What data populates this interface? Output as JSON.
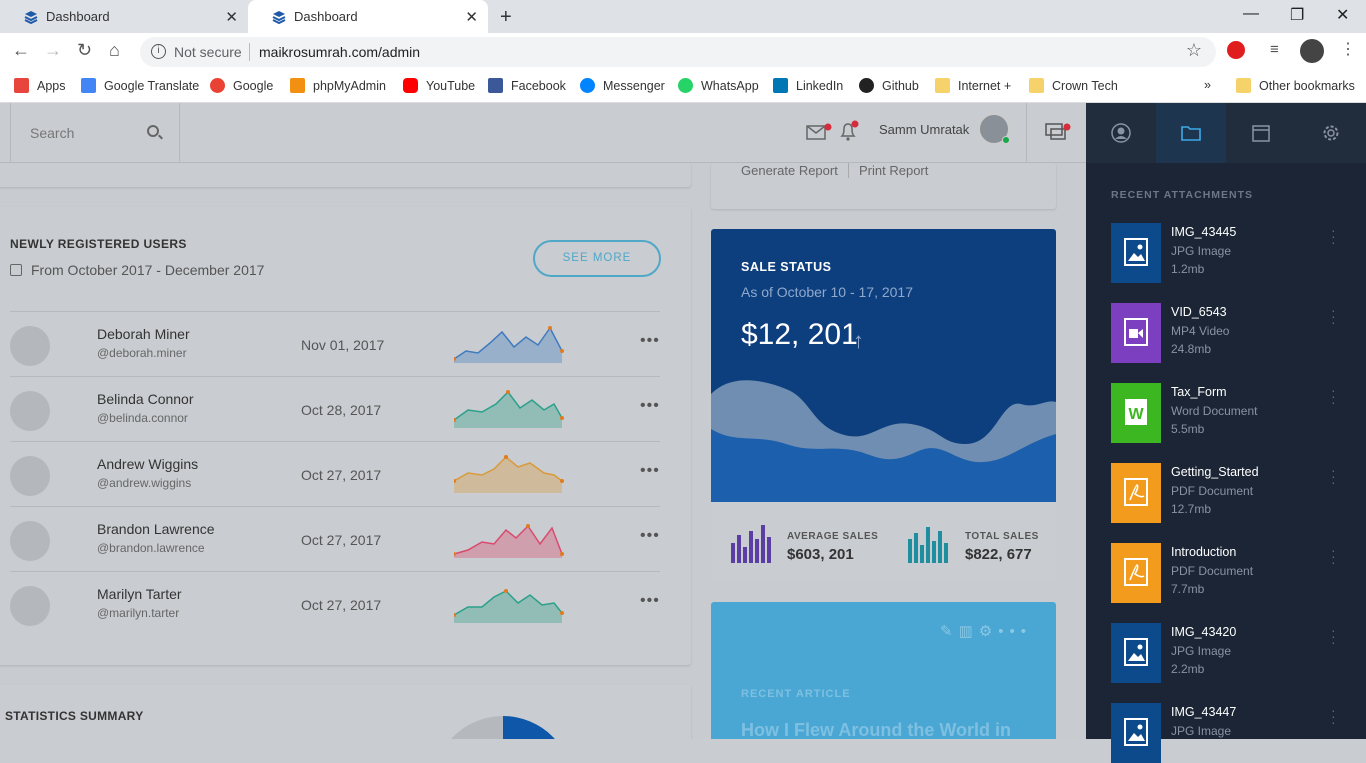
{
  "browser": {
    "tabs": [
      {
        "title": "Dashboard",
        "active": false
      },
      {
        "title": "Dashboard",
        "active": true
      }
    ],
    "address": {
      "security": "Not secure",
      "url": "maikrosumrah.com/admin"
    },
    "bookmarks": [
      {
        "label": "Apps",
        "icon": "apps-grid-icon",
        "color": "#e8453c"
      },
      {
        "label": "Google Translate",
        "icon": "translate-icon",
        "color": "#4285f4"
      },
      {
        "label": "Google",
        "icon": "google-icon",
        "color": "#ea4335"
      },
      {
        "label": "phpMyAdmin",
        "icon": "phpmyadmin-icon",
        "color": "#f29111"
      },
      {
        "label": "YouTube",
        "icon": "youtube-icon",
        "color": "#ff0000"
      },
      {
        "label": "Facebook",
        "icon": "facebook-icon",
        "color": "#3b5998"
      },
      {
        "label": "Messenger",
        "icon": "messenger-icon",
        "color": "#0084ff"
      },
      {
        "label": "WhatsApp",
        "icon": "whatsapp-icon",
        "color": "#25d366"
      },
      {
        "label": "LinkedIn",
        "icon": "linkedin-icon",
        "color": "#0077b5"
      },
      {
        "label": "Github",
        "icon": "github-icon",
        "color": "#222222"
      },
      {
        "label": "Internet +",
        "icon": "folder-icon",
        "color": "#f6d36a"
      },
      {
        "label": "Crown Tech",
        "icon": "folder-icon",
        "color": "#f6d36a"
      },
      {
        "label": "Other bookmarks",
        "icon": "folder-icon",
        "color": "#f6d36a"
      }
    ],
    "overflow": "»"
  },
  "topbar": {
    "search_placeholder": "Search",
    "user_name": "Samm Umratak"
  },
  "report_actions": {
    "generate": "Generate Report",
    "print": "Print Report"
  },
  "new_users": {
    "title": "NEWLY REGISTERED USERS",
    "range": "From October 2017 - December 2017",
    "see_more": "SEE MORE",
    "rows": [
      {
        "name": "Deborah Miner",
        "handle": "@deborah.miner",
        "date": "Nov 01, 2017",
        "color": "#3f7bbf"
      },
      {
        "name": "Belinda Connor",
        "handle": "@belinda.connor",
        "date": "Oct 28, 2017",
        "color": "#2aa08a"
      },
      {
        "name": "Andrew Wiggins",
        "handle": "@andrew.wiggins",
        "date": "Oct 27, 2017",
        "color": "#d99a3c"
      },
      {
        "name": "Brandon Lawrence",
        "handle": "@brandon.lawrence",
        "date": "Oct 27, 2017",
        "color": "#d94a6e"
      },
      {
        "name": "Marilyn Tarter",
        "handle": "@marilyn.tarter",
        "date": "Oct 27, 2017",
        "color": "#2aa08a"
      }
    ]
  },
  "stats": {
    "title": "STATISTICS SUMMARY"
  },
  "sale": {
    "title": "SALE STATUS",
    "subtitle": "As of October 10 - 17, 2017",
    "amount": "$12, 201",
    "average_label": "AVERAGE SALES",
    "average_value": "$603, 201",
    "total_label": "TOTAL SALES",
    "total_value": "$822, 677"
  },
  "article": {
    "label": "RECENT ARTICLE",
    "headline": "How I Flew Around the World in"
  },
  "sidebar": {
    "section": "RECENT ATTACHMENTS",
    "items": [
      {
        "name": "IMG_43445",
        "type": "JPG Image",
        "size": "1.2mb",
        "kind": "image",
        "color": "#0d4a8b"
      },
      {
        "name": "VID_6543",
        "type": "MP4 Video",
        "size": "24.8mb",
        "kind": "video",
        "color": "#7b3fc0"
      },
      {
        "name": "Tax_Form",
        "type": "Word Document",
        "size": "5.5mb",
        "kind": "word",
        "color": "#3cb722"
      },
      {
        "name": "Getting_Started",
        "type": "PDF Document",
        "size": "12.7mb",
        "kind": "pdf",
        "color": "#f29b1c"
      },
      {
        "name": "Introduction",
        "type": "PDF Document",
        "size": "7.7mb",
        "kind": "pdf",
        "color": "#f29b1c"
      },
      {
        "name": "IMG_43420",
        "type": "JPG Image",
        "size": "2.2mb",
        "kind": "image",
        "color": "#0d4a8b"
      },
      {
        "name": "IMG_43447",
        "type": "JPG Image",
        "size": "",
        "kind": "image",
        "color": "#0d4a8b"
      }
    ]
  }
}
